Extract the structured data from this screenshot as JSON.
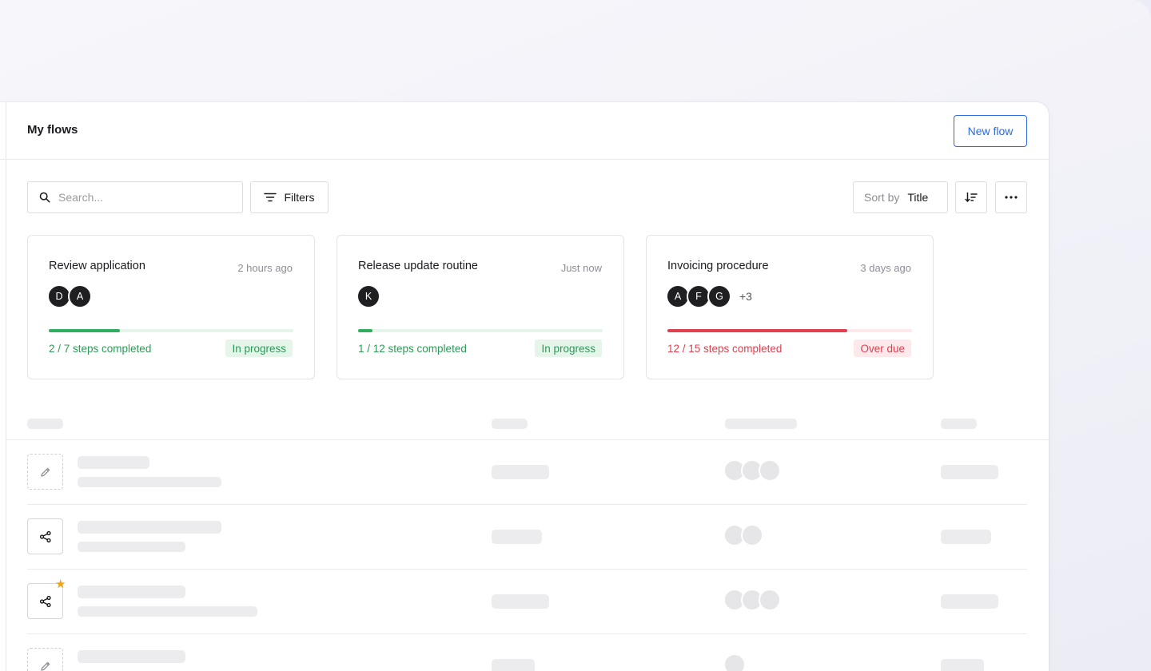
{
  "header": {
    "title": "My flows",
    "new_flow_label": "New flow"
  },
  "toolbar": {
    "search_placeholder": "Search...",
    "filters_label": "Filters",
    "sort_label": "Sort by",
    "sort_value": "Title"
  },
  "cards": [
    {
      "title": "Review application",
      "time": "2 hours ago",
      "avatars": [
        "D",
        "A"
      ],
      "extra": "",
      "progress": 0.29,
      "steps": "2 / 7 steps completed",
      "status": "In progress",
      "status_color": "#2c9a57",
      "status_bg": "#e5f5ea",
      "track_color": "#e5f5ea"
    },
    {
      "title": "Release update routine",
      "time": "Just now",
      "avatars": [
        "K"
      ],
      "extra": "",
      "progress": 0.06,
      "steps": "1 / 12 steps completed",
      "status": "In progress",
      "status_color": "#2c9a57",
      "status_bg": "#e5f5ea",
      "track_color": "#e5f5ea"
    },
    {
      "title": "Invoicing procedure",
      "time": "3 days ago",
      "avatars": [
        "A",
        "F",
        "G"
      ],
      "extra": "+3",
      "progress": 0.735,
      "steps": "12 / 15 steps completed",
      "status": "Over due",
      "status_color": "#e0404e",
      "status_bg": "#fde9ec",
      "track_color": "#fde9ec"
    }
  ],
  "table": {
    "rows": [
      {
        "icon": "pencil-icon",
        "style": "dashed",
        "starred": false,
        "avatar_count": 3
      },
      {
        "icon": "share-icon",
        "style": "solid",
        "starred": false,
        "avatar_count": 2
      },
      {
        "icon": "share-icon",
        "style": "solid",
        "starred": true,
        "avatar_count": 3
      },
      {
        "icon": "pencil-icon",
        "style": "dashed",
        "starred": false,
        "avatar_count": 1
      }
    ]
  },
  "colors": {
    "accent": "#2f6bd8",
    "progress_green": "#2fae5f",
    "progress_red": "#e0404e",
    "star": "#f5a20b"
  }
}
